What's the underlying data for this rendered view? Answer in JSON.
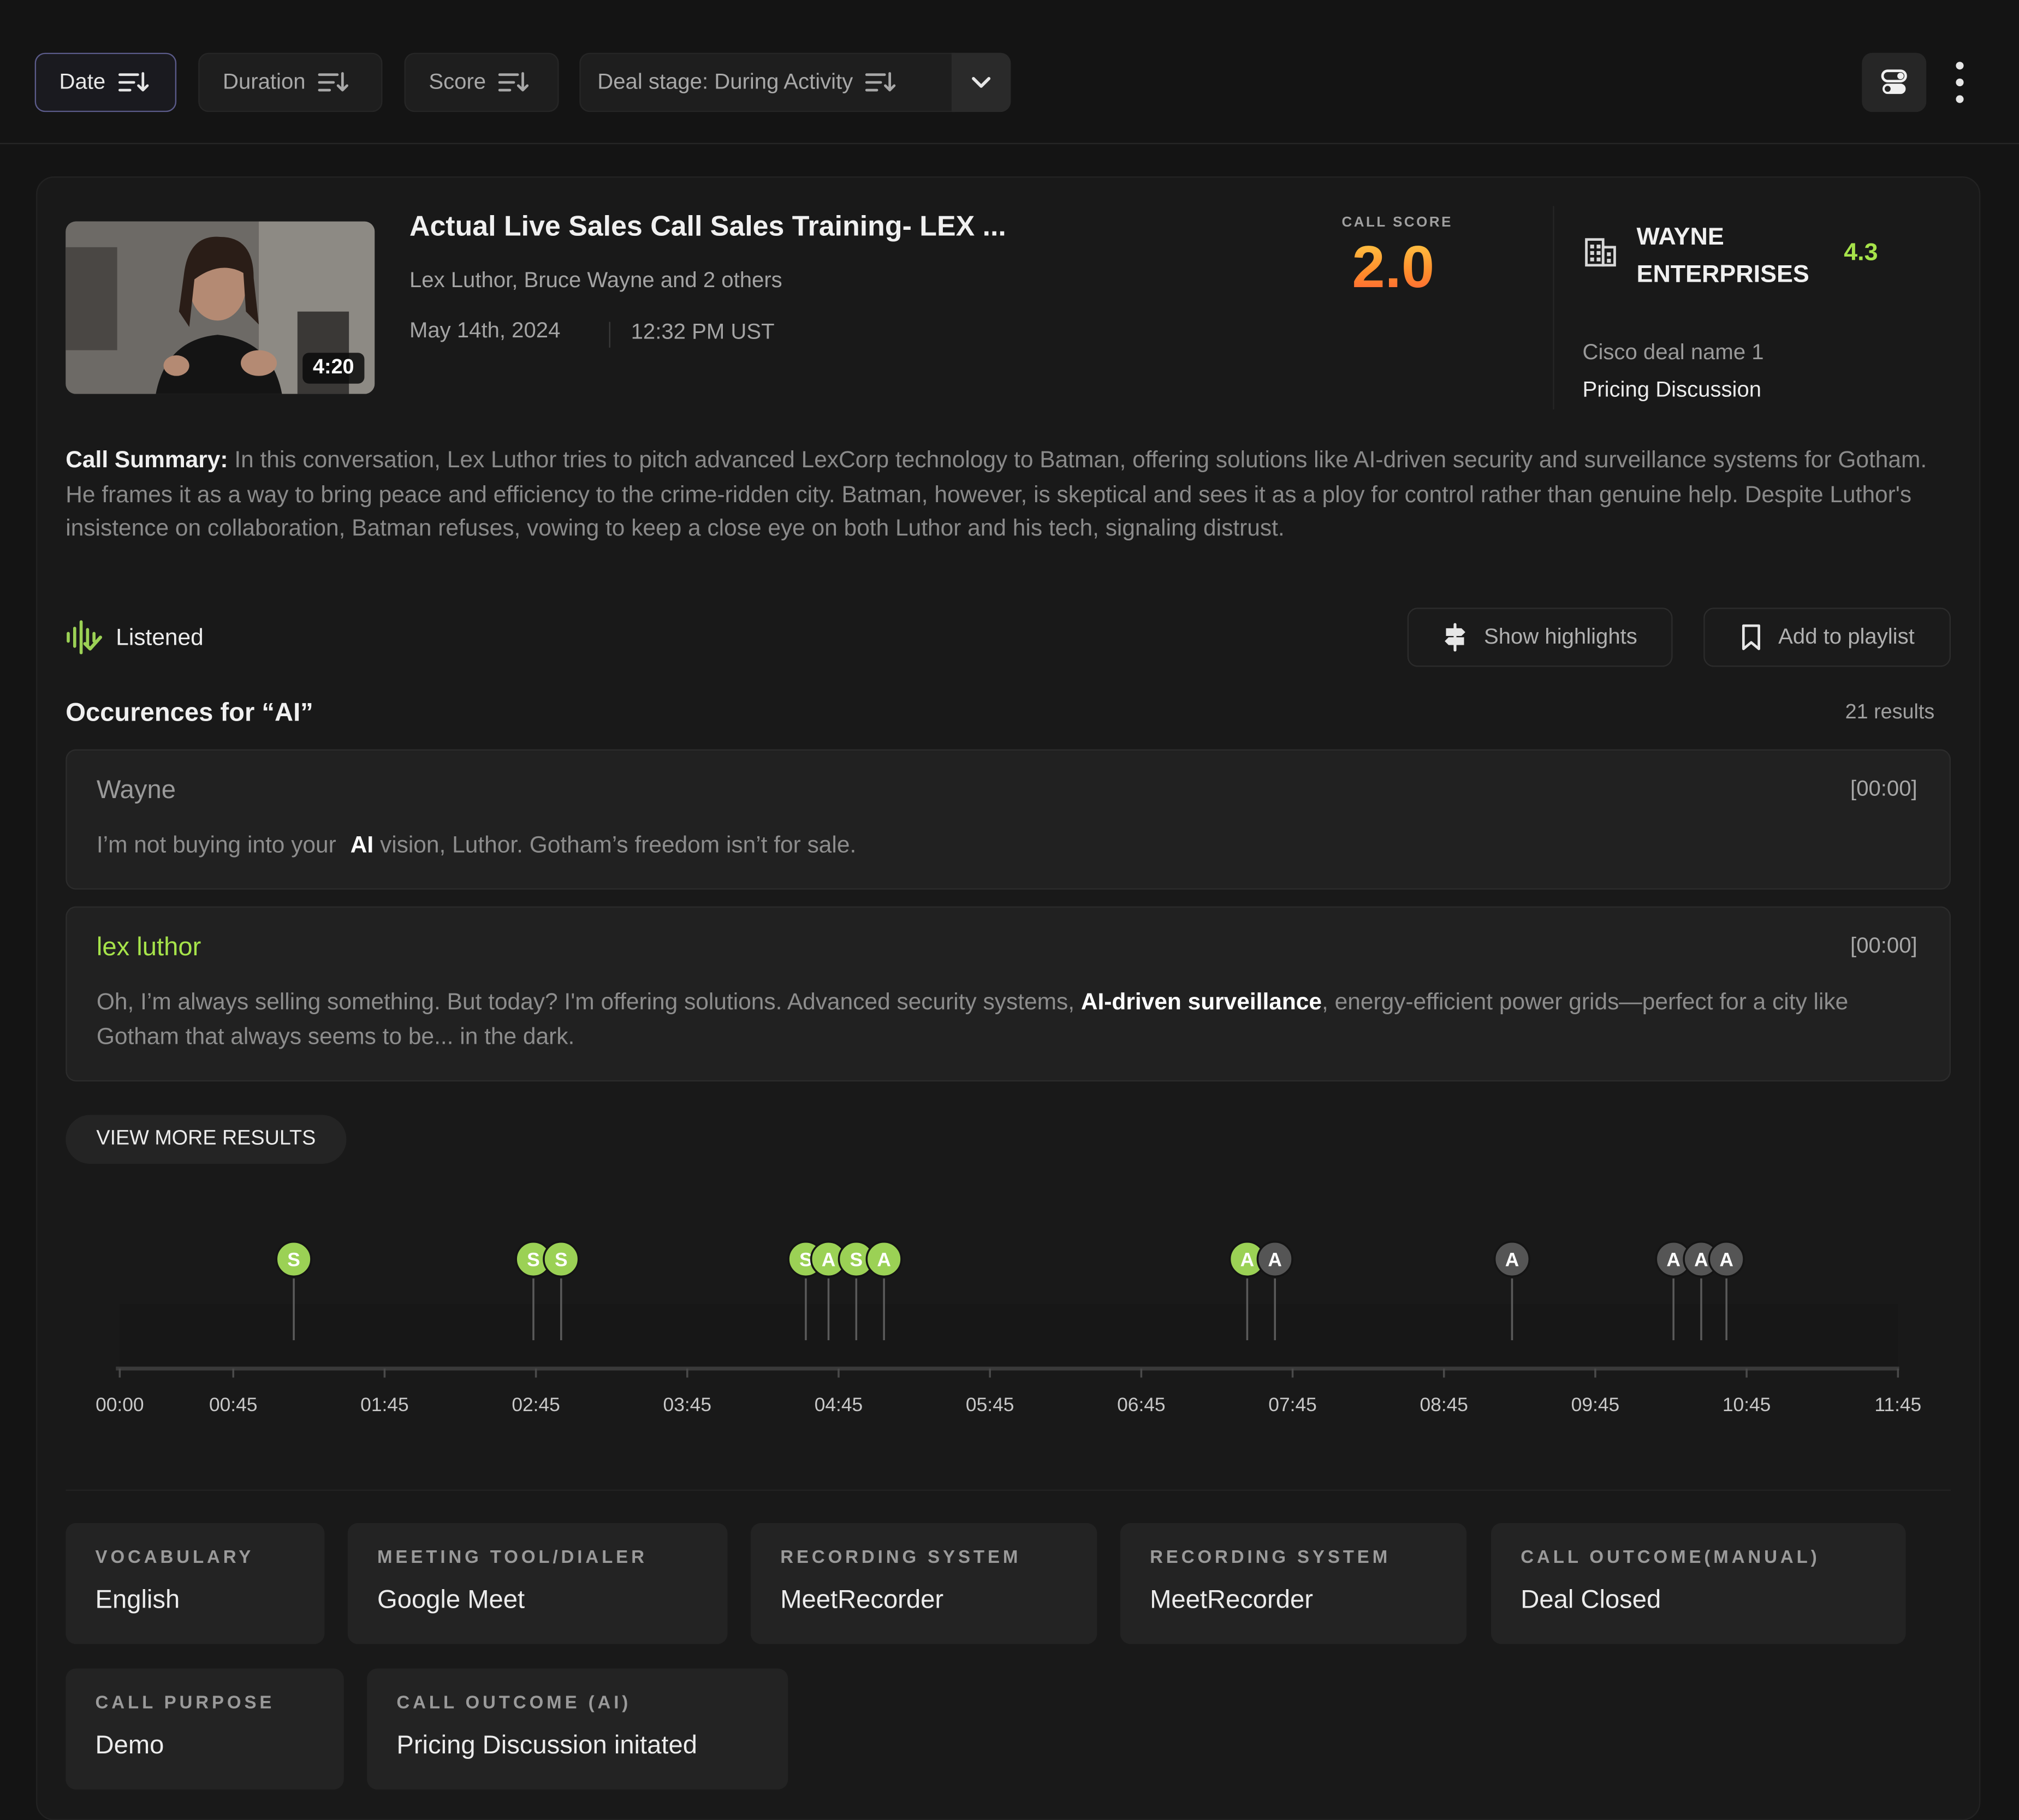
{
  "filters": {
    "date": "Date",
    "duration": "Duration",
    "score": "Score",
    "deal_stage": "Deal stage: During Activity"
  },
  "call": {
    "title": "Actual Live Sales Call Sales Training- LEX ...",
    "participants": "Lex Luthor, Bruce Wayne and 2 others",
    "date": "May 14th, 2024",
    "time": "12:32 PM UST",
    "duration": "4:20",
    "score_label": "CALL SCORE",
    "score": "2.0",
    "score_colors": [
      "#ffd54a",
      "#ff8a2b",
      "#ff5a3a"
    ]
  },
  "company": {
    "name": "WAYNE ENTERPRISES",
    "rating": "4.3",
    "rating_color": "#a6e34a",
    "deal_name": "Cisco deal name 1",
    "deal_stage": "Pricing Discussion"
  },
  "summary": {
    "label": "Call Summary:",
    "text": "In this conversation, Lex Luthor tries to pitch advanced LexCorp technology to Batman, offering solutions like AI-driven security and surveillance systems for Gotham. He frames it as a way to bring peace and efficiency to the crime-ridden city. Batman, however, is skeptical and sees it as a ploy for control rather than genuine help. Despite Luthor's insistence on collaboration, Batman refuses, vowing to keep a close eye on both Luthor and his tech, signaling distrust."
  },
  "status": {
    "listened": "Listened",
    "icon": "soundwave-icon"
  },
  "actions": {
    "show_highlights": "Show highlights",
    "add_to_playlist": "Add to playlist"
  },
  "occurrences": {
    "title": "Occurences for “AI”",
    "count": "21 results",
    "items": [
      {
        "speaker": "Wayne",
        "speaker_color": "#9a9a9a",
        "timestamp": "[00:00]",
        "before": "I’m not buying into your ",
        "keyword": "AI",
        "after": " vision, Luthor. Gotham’s freedom isn’t for sale."
      },
      {
        "speaker": "lex luthor",
        "speaker_color": "#a6e34a",
        "timestamp": "[00:00]",
        "before": "Oh, I’m always selling something. But today? I'm offering solutions. Advanced security systems, ",
        "keyword": "AI-driven surveillance",
        "after": ", energy-efficient power grids—perfect for a city like Gotham that always seems to be... in the dark."
      }
    ],
    "view_more": "VIEW MORE RESULTS"
  },
  "timeline": {
    "range_seconds": [
      0,
      705
    ],
    "ticks": [
      "00:00",
      "00:45",
      "01:45",
      "02:45",
      "03:45",
      "04:45",
      "05:45",
      "06:45",
      "07:45",
      "08:45",
      "09:45",
      "10:45",
      "11:45"
    ],
    "tick_seconds": [
      0,
      45,
      105,
      165,
      225,
      285,
      345,
      405,
      465,
      525,
      585,
      645,
      705
    ],
    "markers": [
      {
        "label": "S",
        "seconds": 69,
        "color": "#9bd155"
      },
      {
        "label": "S",
        "seconds": 164,
        "color": "#9bd155"
      },
      {
        "label": "S",
        "seconds": 175,
        "color": "#9bd155"
      },
      {
        "label": "S",
        "seconds": 272,
        "color": "#9bd155"
      },
      {
        "label": "A",
        "seconds": 281,
        "color": "#9bd155"
      },
      {
        "label": "S",
        "seconds": 292,
        "color": "#9bd155"
      },
      {
        "label": "A",
        "seconds": 303,
        "color": "#9bd155"
      },
      {
        "label": "A",
        "seconds": 447,
        "color": "#9bd155"
      },
      {
        "label": "A",
        "seconds": 458,
        "color": "#555555"
      },
      {
        "label": "A",
        "seconds": 552,
        "color": "#555555"
      },
      {
        "label": "A",
        "seconds": 616,
        "color": "#555555"
      },
      {
        "label": "A",
        "seconds": 627,
        "color": "#555555"
      },
      {
        "label": "A",
        "seconds": 637,
        "color": "#555555"
      }
    ]
  },
  "meta_tiles": [
    {
      "label": "VOCABULARY",
      "value": "English"
    },
    {
      "label": "MEETING TOOL/DIALER",
      "value": "Google Meet"
    },
    {
      "label": "RECORDING SYSTEM",
      "value": "MeetRecorder"
    },
    {
      "label": "RECORDING SYSTEM",
      "value": "MeetRecorder"
    },
    {
      "label": "CALL OUTCOME(MANUAL)",
      "value": "Deal Closed"
    },
    {
      "label": "CALL PURPOSE",
      "value": "Demo"
    },
    {
      "label": "CALL OUTCOME (AI)",
      "value": "Pricing Discussion initated"
    }
  ]
}
